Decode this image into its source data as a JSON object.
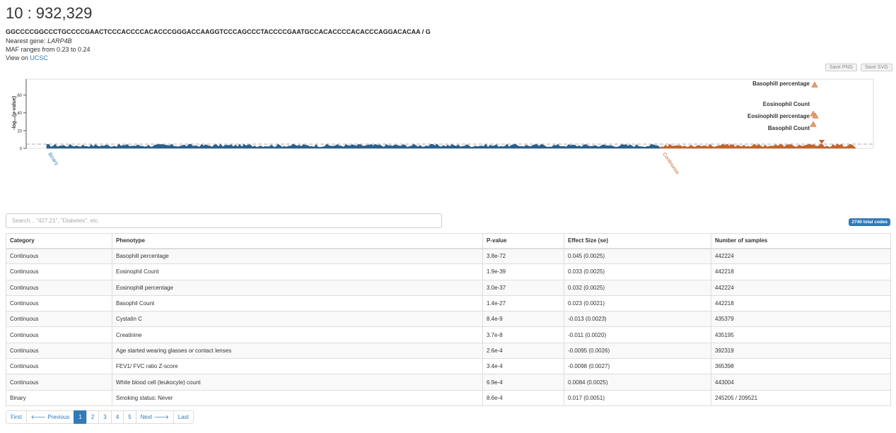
{
  "variant": {
    "title": "10 : 932,329",
    "sequence": "GGCCCCGGCCCTGCCCCGAACTCCCACCCCACACCCGGGACCAAGGTCCCAGCCCTACCCCGAATGCCACACCCCACACCCAGGACACAA / G",
    "nearest_gene_label": "Nearest gene:",
    "nearest_gene": "LARP4B",
    "maf": "MAF ranges from 0.23 to 0.24",
    "view_on_label": "View on",
    "view_on_link": "UCSC"
  },
  "toolbar": {
    "save_png": "Save PNG",
    "save_svg": "Save SVG"
  },
  "plot": {
    "ylabel": "-log₁₀(p-value)",
    "yticks": [
      0,
      20,
      40,
      60
    ],
    "ymax": 78,
    "colors": {
      "binary": "#2b5f8a",
      "continuous": "#c0652f",
      "threshold": "#aaaaaa"
    },
    "categories": [
      "Binary",
      "Continuous"
    ],
    "labeled_points": [
      {
        "label": "Basophill percentage",
        "value": 71.4
      },
      {
        "label": "Eosinophil Count",
        "value": 38.7
      },
      {
        "label": "Eosinophill percentage",
        "value": 36.5
      },
      {
        "label": "Basophil Count",
        "value": 26.9
      }
    ]
  },
  "search": {
    "placeholder": "Search... \"427.21\", \"Diabetes\", etc."
  },
  "badge": "2740 total codes",
  "table": {
    "headers": [
      "Category",
      "Phenotype",
      "P-value",
      "Effect Size (se)",
      "Number of samples"
    ],
    "rows": [
      [
        "Continuous",
        "Basophill percentage",
        "3.8e-72",
        "0.045 (0.0025)",
        "442224"
      ],
      [
        "Continuous",
        "Eosinophil Count",
        "1.9e-39",
        "0.033 (0.0025)",
        "442218"
      ],
      [
        "Continuous",
        "Eosinophill percentage",
        "3.0e-37",
        "0.032 (0.0025)",
        "442224"
      ],
      [
        "Continuous",
        "Basophil Count",
        "1.4e-27",
        "0.023 (0.0021)",
        "442218"
      ],
      [
        "Continuous",
        "Cystatin C",
        "8.4e-9",
        "-0.013 (0.0023)",
        "435379"
      ],
      [
        "Continuous",
        "Creatinine",
        "3.7e-8",
        "-0.011 (0.0020)",
        "435195"
      ],
      [
        "Continuous",
        "Age started wearing glasses or contact lenses",
        "2.6e-4",
        "-0.0095 (0.0026)",
        "392319"
      ],
      [
        "Continuous",
        "FEV1/ FVC ratio Z-score",
        "3.4e-4",
        "-0.0098 (0.0027)",
        "365398"
      ],
      [
        "Continuous",
        "White blood cell (leukocyte) count",
        "6.9e-4",
        "0.0084 (0.0025)",
        "443004"
      ],
      [
        "Binary",
        "Smoking status: Never",
        "8.6e-4",
        "0.017 (0.0051)",
        "245205 / 209521"
      ]
    ]
  },
  "pager": {
    "first": "First",
    "previous": "🡐 Previous",
    "pages": [
      "1",
      "2",
      "3",
      "4",
      "5"
    ],
    "current": "1",
    "next": "Next 🡒",
    "last": "Last"
  }
}
